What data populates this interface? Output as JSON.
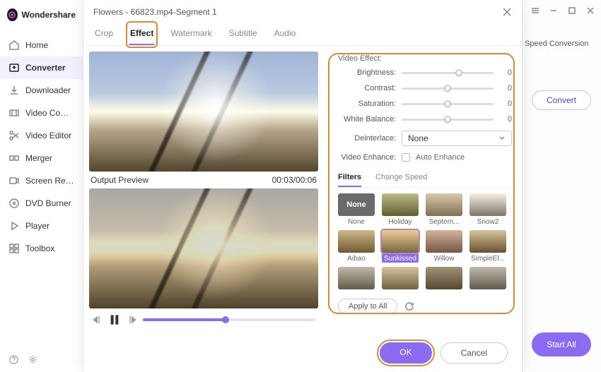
{
  "brand": "Wondershare",
  "sidebar": {
    "items": [
      {
        "label": "Home"
      },
      {
        "label": "Converter"
      },
      {
        "label": "Downloader"
      },
      {
        "label": "Video Compressor"
      },
      {
        "label": "Video Editor"
      },
      {
        "label": "Merger"
      },
      {
        "label": "Screen Recorder"
      },
      {
        "label": "DVD Burner"
      },
      {
        "label": "Player"
      },
      {
        "label": "Toolbox"
      }
    ]
  },
  "right": {
    "speed": "Speed Conversion",
    "convert": "Convert",
    "start_all": "Start All"
  },
  "dialog": {
    "title": "Flowers - 66823.mp4-Segment 1",
    "tabs": [
      "Crop",
      "Effect",
      "Watermark",
      "Subtitle",
      "Audio"
    ],
    "preview_label": "Output Preview",
    "time": "00:03/00:06",
    "video_effect_label": "Video Effect:",
    "sliders": [
      {
        "label": "Brightness:",
        "value": 0,
        "pos": 62
      },
      {
        "label": "Contrast:",
        "value": 0,
        "pos": 50
      },
      {
        "label": "Saturation:",
        "value": 0,
        "pos": 50
      },
      {
        "label": "White Balance:",
        "value": 0,
        "pos": 50
      }
    ],
    "deinterlace_label": "Deinterlace:",
    "deinterlace_value": "None",
    "enhance_label": "Video Enhance:",
    "enhance_option": "Auto Enhance",
    "subtabs": [
      "Filters",
      "Change Speed"
    ],
    "filters": [
      {
        "name": "None",
        "none": true
      },
      {
        "name": "Holiday"
      },
      {
        "name": "Septem..."
      },
      {
        "name": "Snow2"
      },
      {
        "name": "Aibao"
      },
      {
        "name": "Sunkissed",
        "selected": true
      },
      {
        "name": "Willow"
      },
      {
        "name": "SimpleEl..."
      },
      {
        "name": ""
      },
      {
        "name": ""
      },
      {
        "name": ""
      },
      {
        "name": ""
      }
    ],
    "apply_all": "Apply to All",
    "ok": "OK",
    "cancel": "Cancel"
  }
}
